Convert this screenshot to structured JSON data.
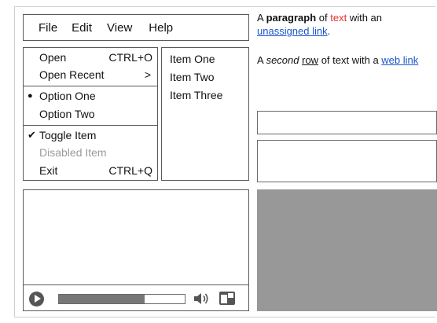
{
  "menubar": {
    "items": [
      "File",
      "Edit",
      "View",
      "Help"
    ]
  },
  "menu": {
    "open": {
      "label": "Open",
      "shortcut": "CTRL+O"
    },
    "open_recent": {
      "label": "Open Recent",
      "submenu": ">"
    },
    "option_one": {
      "label": "Option One",
      "mark": "●"
    },
    "option_two": {
      "label": "Option Two"
    },
    "toggle_item": {
      "label": "Toggle Item",
      "mark": "✔"
    },
    "disabled_item": {
      "label": "Disabled Item"
    },
    "exit": {
      "label": "Exit",
      "shortcut": "CTRL+Q"
    }
  },
  "list": {
    "items": [
      "Item One",
      "Item Two",
      "Item Three"
    ]
  },
  "paragraph1": {
    "prefix": "A ",
    "bold": "paragraph",
    "mid": " of ",
    "red": "text",
    "suffix": " with an ",
    "link": "unassigned link",
    "end": "."
  },
  "paragraph2": {
    "prefix": "A ",
    "italic": "second",
    "space": " ",
    "underlined": "row",
    "mid": " of text with a ",
    "link": "web link"
  },
  "input1": {
    "value": ""
  },
  "input2": {
    "value": ""
  },
  "video": {
    "progress": 0.68,
    "play_icon": "play-icon",
    "volume_icon": "volume-icon",
    "fullscreen_icon": "fullscreen-icon"
  },
  "colors": {
    "red_text": "#e2312b",
    "link": "#1a55c9",
    "image_placeholder": "#989898"
  }
}
